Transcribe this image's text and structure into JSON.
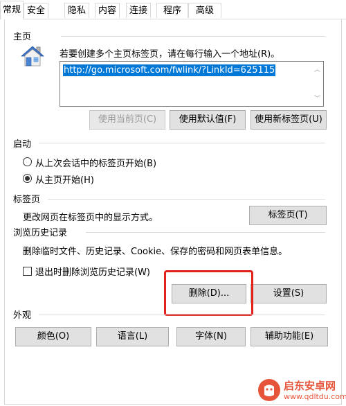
{
  "tabs": [
    "常规",
    "安全",
    "隐私",
    "内容",
    "连接",
    "程序",
    "高级"
  ],
  "homepage": {
    "title": "主页",
    "instruction": "若要创建多个主页标签页，请在每行输入一个地址(R)。",
    "url": "http://go.microsoft.com/fwlink/?LinkId=625115",
    "buttons": {
      "use_current": "使用当前页(C)",
      "use_default": "使用默认值(F)",
      "use_new_tab": "使用新标签页(U)"
    }
  },
  "startup": {
    "title": "启动",
    "option1": "从上次会话中的标签页开始(B)",
    "option2": "从主页开始(H)",
    "selected": 2
  },
  "tabs_section": {
    "title": "标签页",
    "description": "更改网页在标签页中的显示方式。",
    "button": "标签页(T)"
  },
  "history": {
    "title": "浏览历史记录",
    "description": "删除临时文件、历史记录、Cookie、保存的密码和网页表单信息。",
    "checkbox_label": "退出时删除浏览历史记录(W)",
    "checked": false,
    "delete_button": "删除(D)...",
    "settings_button": "设置(S)"
  },
  "appearance": {
    "title": "外观",
    "buttons": {
      "colors": "颜色(O)",
      "languages": "语言(L)",
      "fonts": "字体(N)",
      "accessibility": "辅助功能(E)"
    }
  },
  "watermark": {
    "brand": "启东安卓网",
    "url": "www.qdltdu.com"
  },
  "colors": {
    "highlight_box": "#e0211c",
    "selection": "#0078d7",
    "watermark": "#e6553a"
  }
}
